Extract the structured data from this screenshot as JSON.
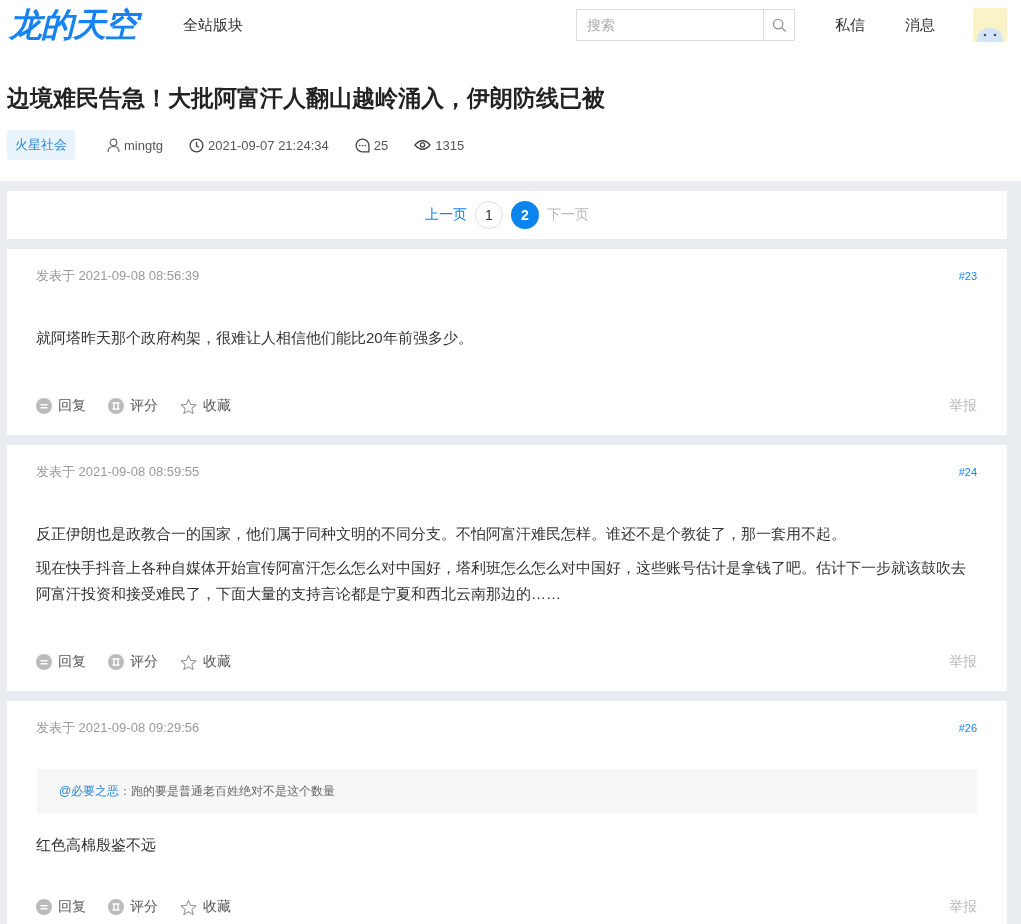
{
  "header": {
    "logo": "龙的天空",
    "nav": "全站版块",
    "search": {
      "placeholder": "搜索"
    },
    "links": [
      "私信",
      "消息"
    ]
  },
  "thread": {
    "title": "边境难民告急！大批阿富汗人翻山越岭涌入，伊朗防线已被",
    "forum": "火星社会",
    "author": "mingtg",
    "time": "2021-09-07 21:24:34",
    "replies": "25",
    "views": "1315"
  },
  "pagination": {
    "prev": {
      "label": "上一页",
      "disabled": false
    },
    "pages": [
      {
        "label": "1",
        "selected": false
      },
      {
        "label": "2",
        "selected": true
      }
    ],
    "next": {
      "label": "下一页",
      "disabled": true
    }
  },
  "posts": [
    {
      "date": "发表于 2021-09-08 08:56:39",
      "floor": "#23",
      "paragraphs": [
        "就阿塔昨天那个政府构架，很难让人相信他们能比20年前强多少。"
      ],
      "actions": [
        {
          "kind": "reply",
          "label": "回复"
        },
        {
          "kind": "rate",
          "label": "评分"
        },
        {
          "kind": "favorite",
          "label": "收藏"
        }
      ],
      "report": "举报"
    },
    {
      "date": "发表于 2021-09-08 08:59:55",
      "floor": "#24",
      "paragraphs": [
        "反正伊朗也是政教合一的国家，他们属于同种文明的不同分支。不怕阿富汗难民怎样。谁还不是个教徒了，那一套用不起。",
        "现在快手抖音上各种自媒体开始宣传阿富汗怎么怎么对中国好，塔利班怎么怎么对中国好，这些账号估计是拿钱了吧。估计下一步就该鼓吹去阿富汗投资和接受难民了，下面大量的支持言论都是宁夏和西北云南那边的……"
      ],
      "actions": [
        {
          "kind": "reply",
          "label": "回复"
        },
        {
          "kind": "rate",
          "label": "评分"
        },
        {
          "kind": "favorite",
          "label": "收藏"
        }
      ],
      "report": "举报"
    },
    {
      "date": "发表于 2021-09-08 09:29:56",
      "floor": "#26",
      "quote": {
        "user": "@必要之恶",
        "sep": "：",
        "text": "跑的要是普通老百姓绝对不是这个数量"
      },
      "paragraphs": [
        "红色高棉殷鉴不远"
      ],
      "actions": [
        {
          "kind": "reply",
          "label": "回复"
        },
        {
          "kind": "rate",
          "label": "评分"
        },
        {
          "kind": "favorite",
          "label": "收藏"
        }
      ],
      "report": "举报"
    }
  ]
}
